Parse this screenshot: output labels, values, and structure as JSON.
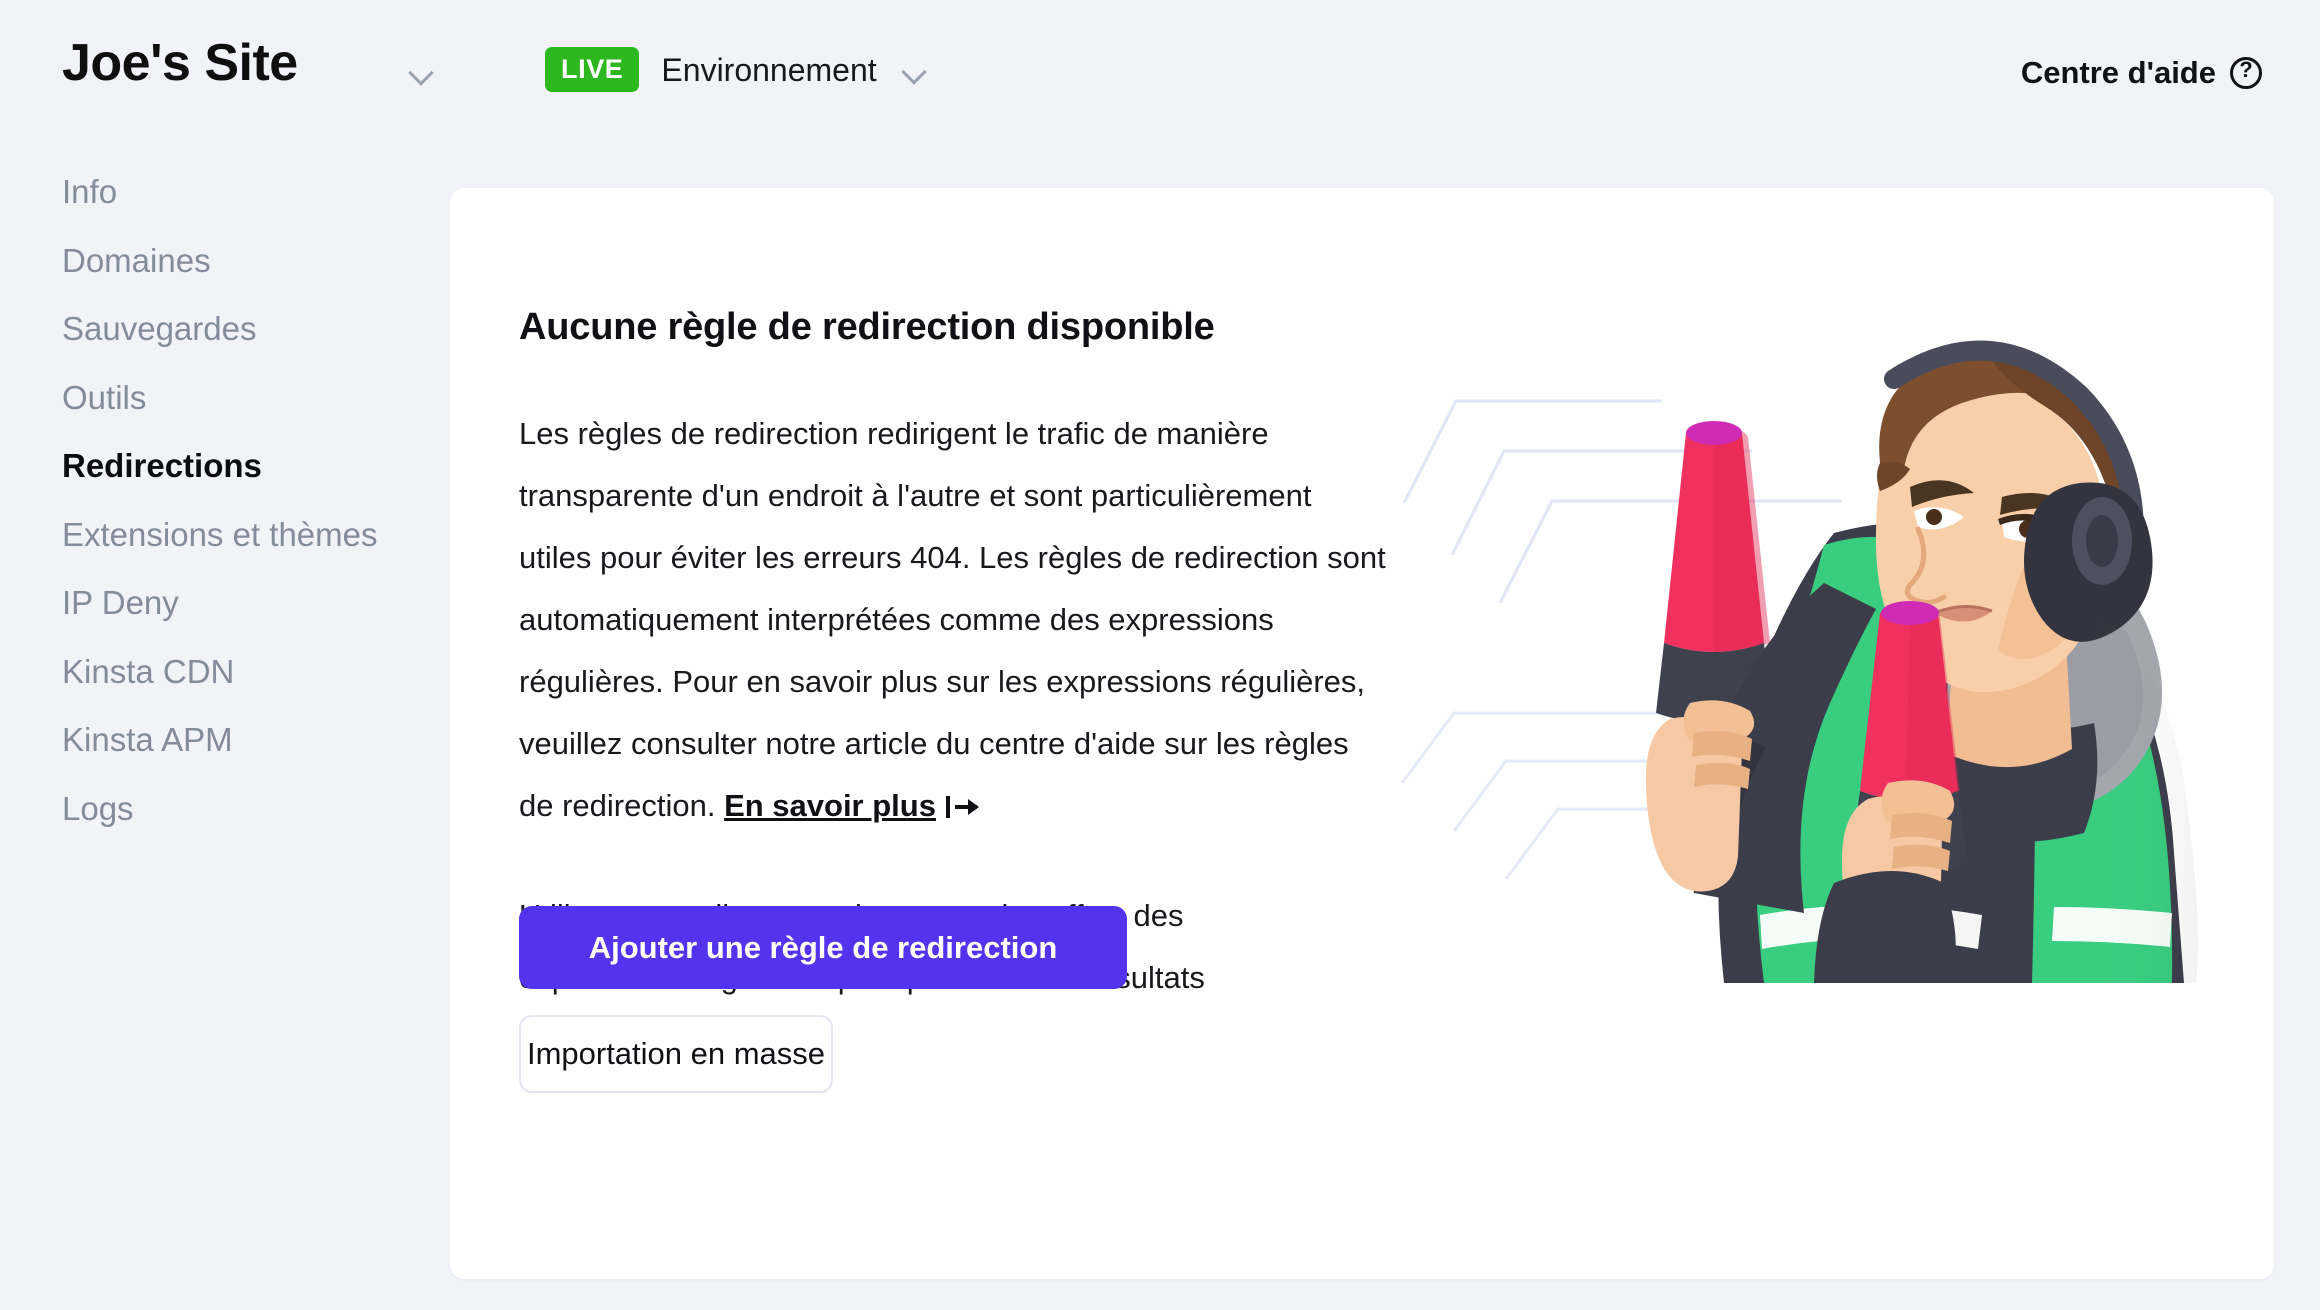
{
  "header": {
    "site_title": "Joe's Site",
    "site_chevron_icon": "chevron-down-icon",
    "environment": {
      "badge": "LIVE",
      "badge_color": "#2cb81e",
      "label": "Environnement",
      "chevron_icon": "chevron-down-icon"
    },
    "help": {
      "label": "Centre d'aide",
      "icon": "question-circle-icon"
    }
  },
  "sidebar": {
    "items": [
      {
        "label": "Info",
        "active": false
      },
      {
        "label": "Domaines",
        "active": false
      },
      {
        "label": "Sauvegardes",
        "active": false
      },
      {
        "label": "Outils",
        "active": false
      },
      {
        "label": "Redirections",
        "active": true
      },
      {
        "label": "Extensions et thèmes",
        "active": false
      },
      {
        "label": "IP Deny",
        "active": false
      },
      {
        "label": "Kinsta CDN",
        "active": false
      },
      {
        "label": "Kinsta APM",
        "active": false
      },
      {
        "label": "Logs",
        "active": false
      }
    ]
  },
  "main": {
    "heading": "Aucune règle de redirection disponible",
    "paragraph1_before_link": "Les règles de redirection redirigent le trafic de manière transparente d'un endroit à l'autre et sont particulièrement utiles pour éviter les erreurs 404. Les règles de redirection sont automatiquement interprétées comme des expressions régulières. Pour en savoir plus sur les expressions régulières, veuillez consulter notre article du centre d'aide sur les règles de redirection. ",
    "learn_more_label": "En savoir plus",
    "learn_more_icon": "external-arrow-icon",
    "paragraph2": "Utiliser cet outil sans tenir compte des effets des expressions régulières peut produire des résultats inattendus.",
    "primary_button": "Ajouter une règle de redirection",
    "secondary_button": "Importation en masse",
    "illustration_name": "marshaller-with-wands-illustration"
  },
  "colors": {
    "page_background": "#f1f3f8",
    "card_background": "#ffffff",
    "accent_purple": "#5333ed",
    "live_green": "#2cb81e",
    "muted_text": "#848c9c",
    "body_text": "#17191d"
  }
}
